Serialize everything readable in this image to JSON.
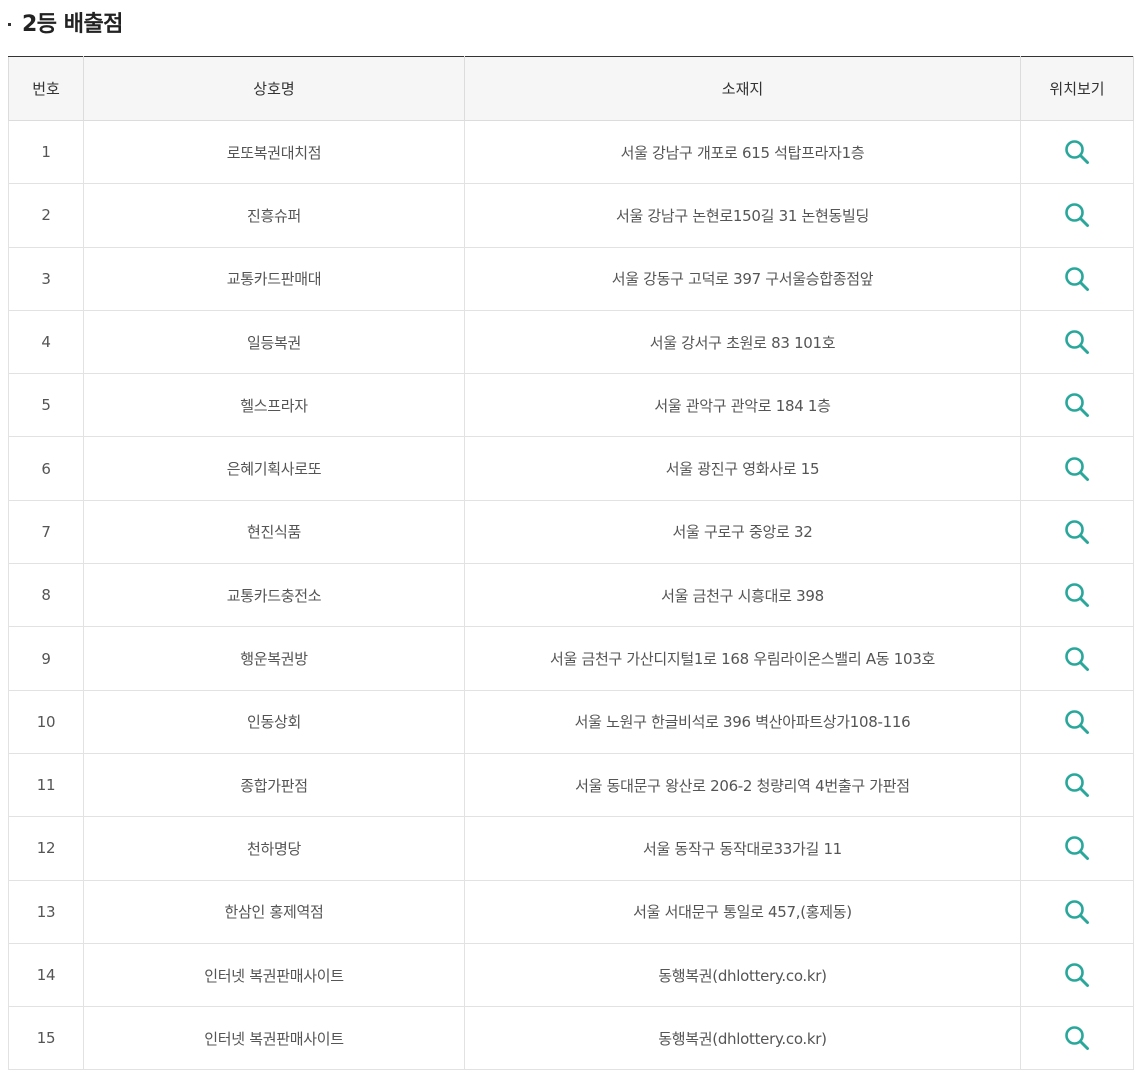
{
  "section": {
    "title": "2등 배출점"
  },
  "table": {
    "headers": {
      "no": "번호",
      "name": "상호명",
      "address": "소재지",
      "map": "위치보기"
    },
    "rows": [
      {
        "no": "1",
        "name": "로또복권대치점",
        "address": "서울 강남구 개포로 615 석탑프라자1층",
        "map_icon": "search-icon"
      },
      {
        "no": "2",
        "name": "진흥슈퍼",
        "address": "서울 강남구 논현로150길 31 논현동빌딩",
        "map_icon": "search-icon"
      },
      {
        "no": "3",
        "name": "교통카드판매대",
        "address": "서울 강동구 고덕로 397 구서울승합종점앞",
        "map_icon": "search-icon"
      },
      {
        "no": "4",
        "name": "일등복권",
        "address": "서울 강서구 초원로 83 101호",
        "map_icon": "search-icon"
      },
      {
        "no": "5",
        "name": "헬스프라자",
        "address": "서울 관악구 관악로 184 1층",
        "map_icon": "search-icon"
      },
      {
        "no": "6",
        "name": "은혜기획사로또",
        "address": "서울 광진구 영화사로 15",
        "map_icon": "search-icon"
      },
      {
        "no": "7",
        "name": "현진식품",
        "address": "서울 구로구 중앙로 32",
        "map_icon": "search-icon"
      },
      {
        "no": "8",
        "name": "교통카드충전소",
        "address": "서울 금천구 시흥대로 398",
        "map_icon": "search-icon"
      },
      {
        "no": "9",
        "name": "행운복권방",
        "address": "서울 금천구 가산디지털1로 168 우림라이온스밸리 A동 103호",
        "map_icon": "search-icon"
      },
      {
        "no": "10",
        "name": "인동상회",
        "address": "서울 노원구 한글비석로 396 벽산아파트상가108-116",
        "map_icon": "search-icon"
      },
      {
        "no": "11",
        "name": "종합가판점",
        "address": "서울 동대문구 왕산로 206-2 청량리역 4번출구 가판점",
        "map_icon": "search-icon"
      },
      {
        "no": "12",
        "name": "천하명당",
        "address": "서울 동작구 동작대로33가길 11",
        "map_icon": "search-icon"
      },
      {
        "no": "13",
        "name": "한삼인 홍제역점",
        "address": "서울 서대문구 통일로 457,(홍제동)",
        "map_icon": "search-icon"
      },
      {
        "no": "14",
        "name": "인터넷 복권판매사이트",
        "address": "동행복권(dhlottery.co.kr)",
        "map_icon": "search-icon"
      },
      {
        "no": "15",
        "name": "인터넷 복권판매사이트",
        "address": "동행복권(dhlottery.co.kr)",
        "map_icon": "search-icon"
      }
    ]
  },
  "colors": {
    "icon": "#2aa79b",
    "header_bg": "#f6f6f6",
    "text": "#555555"
  }
}
